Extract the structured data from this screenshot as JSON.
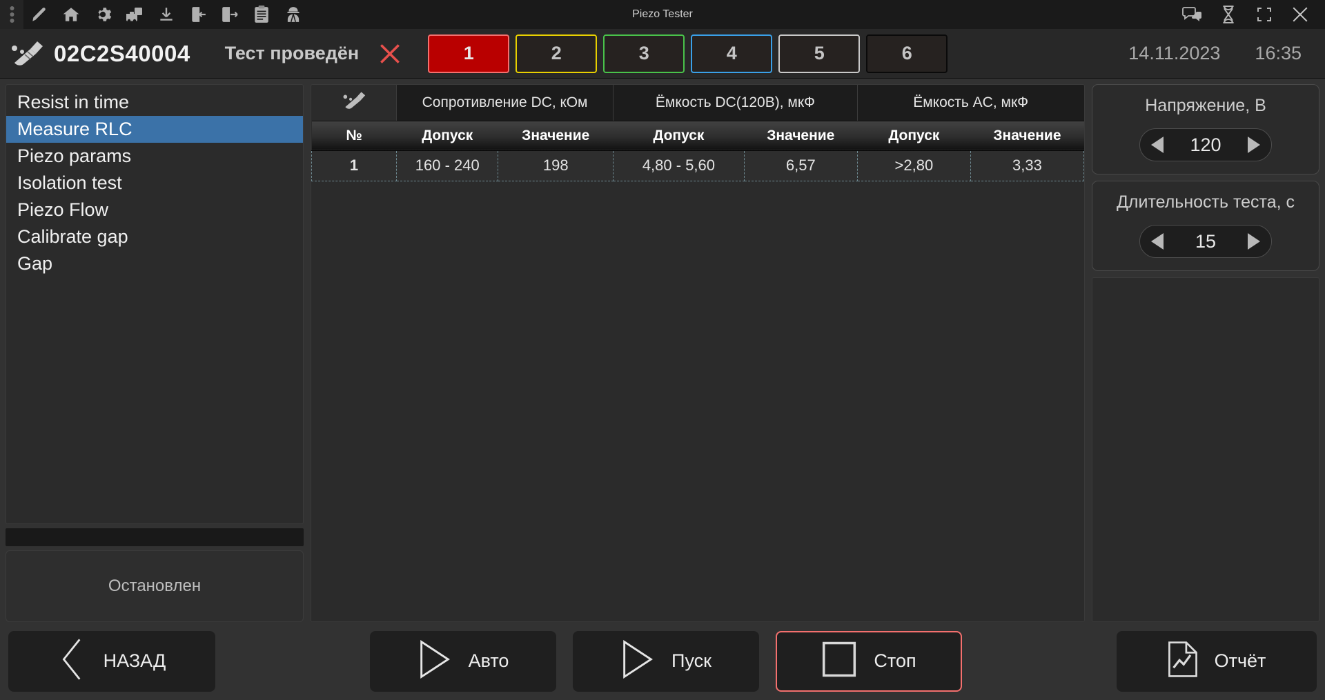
{
  "window": {
    "title": "Piezo Tester",
    "toolbar_icons": [
      "kebab-menu-icon",
      "pencil-icon",
      "home-icon",
      "gear-icon",
      "toolbox-icon",
      "download-icon",
      "import-icon",
      "export-icon",
      "clipboard-icon",
      "worker-icon"
    ],
    "controls": [
      "chat-icon",
      "hourglass-icon",
      "maximize-icon",
      "close-icon"
    ]
  },
  "header": {
    "broom_icon": "broom-icon",
    "serial": "02C2S40004",
    "status": "Тест проведён",
    "close_result_icon": "red-x-icon",
    "channels": [
      {
        "label": "1",
        "border": "#f4706e",
        "fill": "#b90000",
        "active": true
      },
      {
        "label": "2",
        "border": "#e8d000",
        "fill": "#262220",
        "active": false
      },
      {
        "label": "3",
        "border": "#49c24a",
        "fill": "#262220",
        "active": false
      },
      {
        "label": "4",
        "border": "#3aa0e8",
        "fill": "#262220",
        "active": false
      },
      {
        "label": "5",
        "border": "#c9c9c9",
        "fill": "#262220",
        "active": false
      },
      {
        "label": "6",
        "border": "#0a0a0a",
        "fill": "#262220",
        "active": false
      }
    ],
    "date": "14.11.2023",
    "time": "16:35"
  },
  "sidebar": {
    "items": [
      {
        "label": "Resist in time",
        "selected": false
      },
      {
        "label": "Measure RLC",
        "selected": true
      },
      {
        "label": "Piezo params",
        "selected": false
      },
      {
        "label": "Isolation test",
        "selected": false
      },
      {
        "label": "Piezo Flow",
        "selected": false
      },
      {
        "label": "Calibrate gap",
        "selected": false
      },
      {
        "label": "Gap",
        "selected": false
      }
    ],
    "selected_color": "#3b72a8",
    "progress_value": 0,
    "status_text": "Остановлен"
  },
  "table": {
    "clear_icon": "broom-icon",
    "group_headers": [
      "Сопротивление DC, кОм",
      "Ёмкость DC(120В), мкФ",
      "Ёмкость AC, мкФ"
    ],
    "columns": [
      "№",
      "Допуск",
      "Значение",
      "Допуск",
      "Значение",
      "Допуск",
      "Значение"
    ],
    "rows": [
      [
        "1",
        "160 - 240",
        "198",
        "4,80 - 5,60",
        "6,57",
        ">2,80",
        "3,33"
      ]
    ]
  },
  "params": [
    {
      "label": "Напряжение, В",
      "value": "120"
    },
    {
      "label": "Длительность теста, с",
      "value": "15"
    }
  ],
  "footer": {
    "back": {
      "label": "НАЗАД",
      "icon": "chevron-left-icon"
    },
    "auto": {
      "label": "Авто",
      "icon": "play-icon"
    },
    "start": {
      "label": "Пуск",
      "icon": "play-icon"
    },
    "stop": {
      "label": "Стоп",
      "icon": "stop-square-icon",
      "accent": "#f4706e"
    },
    "report": {
      "label": "Отчёт",
      "icon": "report-document-icon"
    }
  }
}
